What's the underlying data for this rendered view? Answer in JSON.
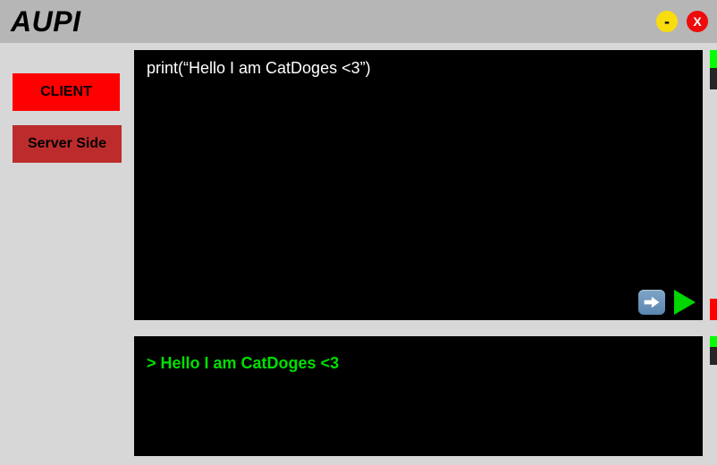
{
  "app": {
    "title": "AUPI"
  },
  "window": {
    "minimize_label": "-",
    "close_label": "X"
  },
  "sidebar": {
    "client_label": "CLIENT",
    "server_label": "Server Side"
  },
  "editor": {
    "content": "print(“Hello I am CatDoges <3”)"
  },
  "console": {
    "output": "> Hello I am CatDoges <3"
  },
  "colors": {
    "titlebar": "#b6b6b6",
    "body": "#d7d7d7",
    "btn_client": "#ff0000",
    "btn_server": "#bd2c2c",
    "editor_bg": "#000000",
    "editor_fg": "#ffffff",
    "console_fg": "#00e000",
    "scroll_green": "#00ff00",
    "scroll_red": "#ff0000",
    "scroll_dark": "#262626",
    "play": "#00d600",
    "minimize": "#f9dc0d",
    "close": "#ee0b0b"
  }
}
